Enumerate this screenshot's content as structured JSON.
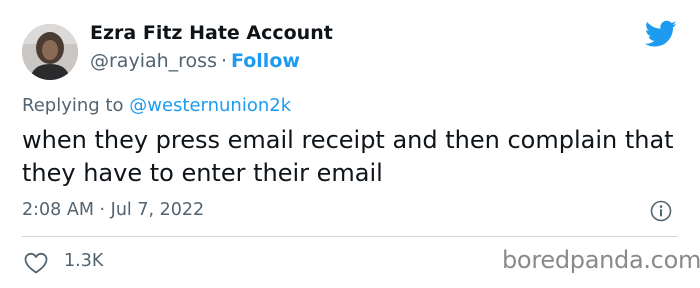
{
  "author": {
    "display_name": "Ezra Fitz Hate Account",
    "handle": "@rayiah_ross",
    "separator": "·",
    "follow_label": "Follow"
  },
  "reply": {
    "prefix": "Replying to",
    "mention": "@westernunion2k"
  },
  "tweet": {
    "text": "when they press email receipt and then complain that they have to enter their email",
    "time": "2:08 AM",
    "separator": "·",
    "date": "Jul 7, 2022"
  },
  "metrics": {
    "likes": "1.3K"
  },
  "watermark": "boredpanda.com",
  "colors": {
    "twitter_blue": "#1d9bf0",
    "secondary_text": "#536471",
    "primary_text": "#0f1419",
    "divider": "#cfd9de"
  },
  "icons": {
    "brand": "twitter-bird-icon",
    "info": "info-icon",
    "like": "heart-icon"
  }
}
